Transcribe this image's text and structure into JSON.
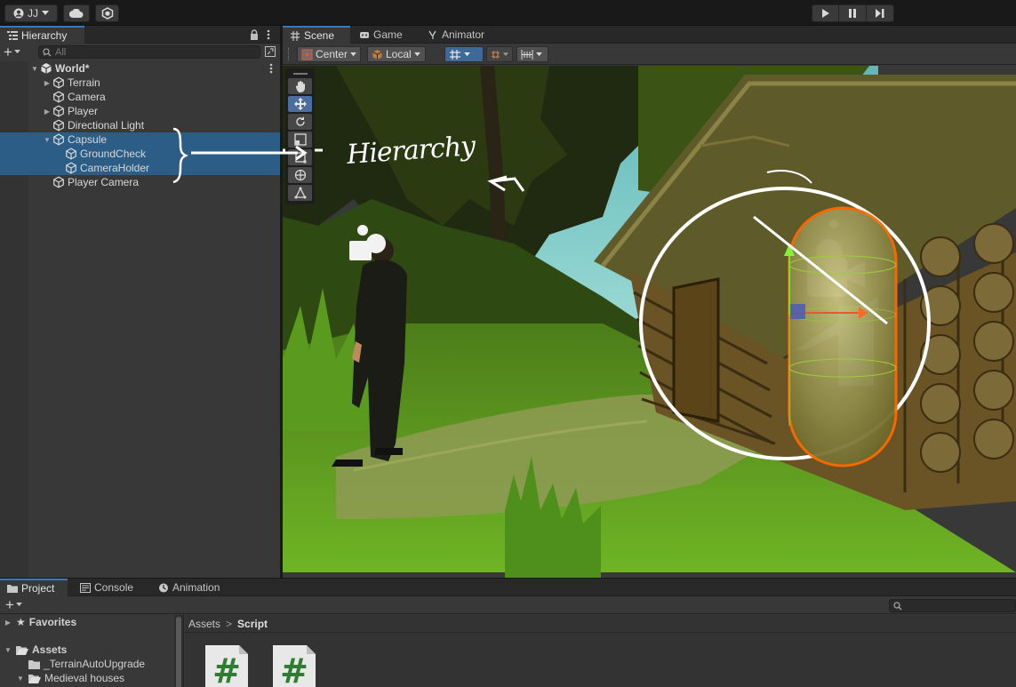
{
  "toolbar": {
    "account_label": "JJ",
    "account_icon": "user-icon",
    "cloud_icon": "cloud-icon",
    "collab_icon": "collab-icon",
    "play_icon": "play-icon",
    "pause_icon": "pause-icon",
    "step_icon": "step-icon"
  },
  "hierarchy": {
    "tab_label": "Hierarchy",
    "add_label": "+",
    "search_placeholder": "All",
    "scene_name": "World*",
    "items": [
      {
        "label": "Terrain",
        "expandable": true,
        "selected": false,
        "indent": 1
      },
      {
        "label": "Camera",
        "expandable": false,
        "selected": false,
        "indent": 1
      },
      {
        "label": "Player",
        "expandable": true,
        "selected": false,
        "indent": 1
      },
      {
        "label": "Directional Light",
        "expandable": false,
        "selected": false,
        "indent": 1
      },
      {
        "label": "Capsule",
        "expandable": true,
        "expanded": true,
        "selected": true,
        "indent": 1
      },
      {
        "label": "GroundCheck",
        "expandable": false,
        "selected": true,
        "indent": 2
      },
      {
        "label": "CameraHolder",
        "expandable": false,
        "selected": true,
        "indent": 2
      },
      {
        "label": "Player Camera",
        "expandable": false,
        "selected": false,
        "indent": 1
      }
    ]
  },
  "scene": {
    "tabs": [
      {
        "label": "Scene",
        "icon": "grid-icon",
        "active": true
      },
      {
        "label": "Game",
        "icon": "gamepad-icon",
        "active": false
      },
      {
        "label": "Animator",
        "icon": "animator-icon",
        "active": false
      }
    ],
    "pivot_label": "Center",
    "space_label": "Local",
    "annotation_text": "Hierarchy",
    "tools": [
      "hand-tool",
      "move-tool",
      "rotate-tool",
      "scale-tool",
      "rect-tool",
      "transform-tool",
      "custom-tool"
    ],
    "active_tool": "move-tool"
  },
  "project": {
    "tabs": [
      {
        "label": "Project",
        "icon": "folder-icon",
        "active": true
      },
      {
        "label": "Console",
        "icon": "console-icon",
        "active": false
      },
      {
        "label": "Animation",
        "icon": "animation-icon",
        "active": false
      }
    ],
    "add_label": "+",
    "tree": {
      "favorites_label": "Favorites",
      "assets_label": "Assets",
      "children": [
        "_TerrainAutoUpgrade",
        "Medieval houses"
      ]
    },
    "breadcrumb": {
      "root": "Assets",
      "separator": ">",
      "current": "Script"
    },
    "asset_glyph": "#"
  },
  "colors": {
    "selection": "#2c5d87",
    "accent": "#3a79bb",
    "capsule_outline": "#ff6a00",
    "script_green": "#2e7d32"
  }
}
